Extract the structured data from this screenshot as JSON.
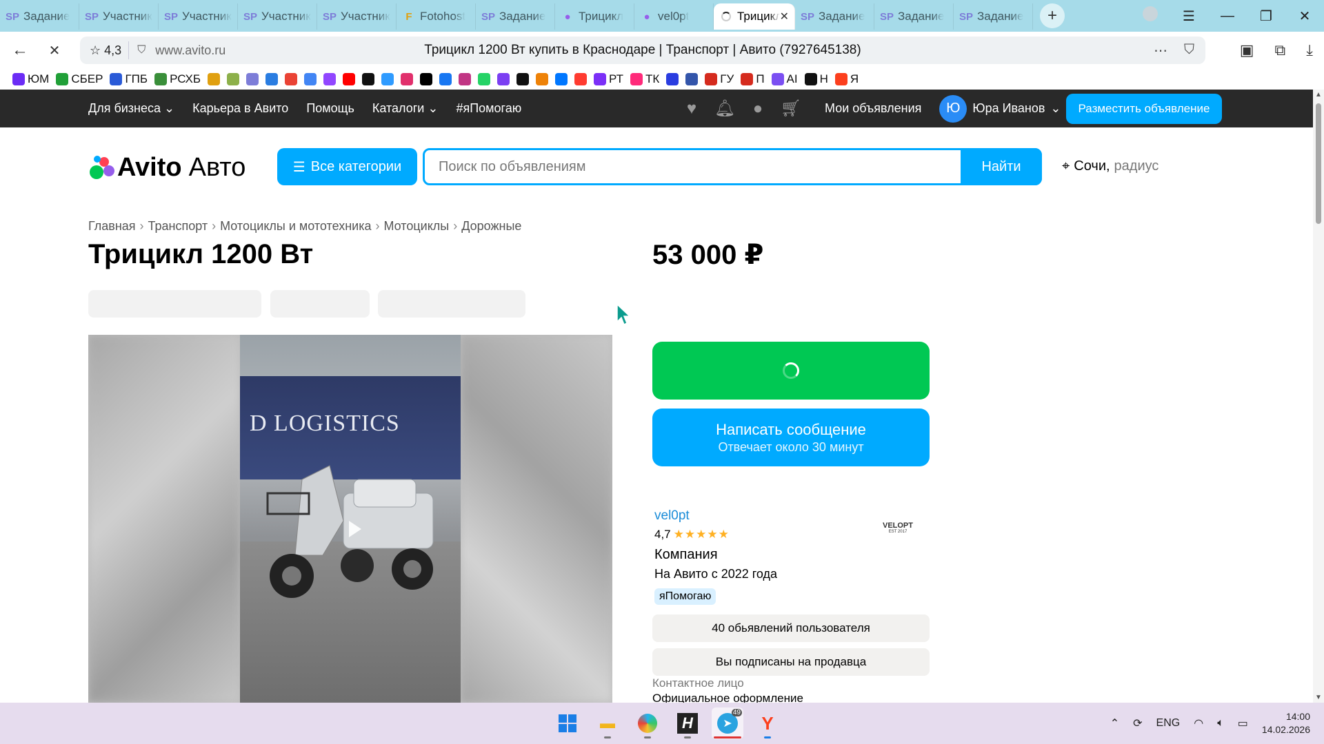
{
  "browser": {
    "tabs": [
      {
        "icon": "sp-icon",
        "title": "Задание"
      },
      {
        "icon": "sp-icon",
        "title": "Участник"
      },
      {
        "icon": "sp-icon",
        "title": "Участник"
      },
      {
        "icon": "sp-icon",
        "title": "Участник"
      },
      {
        "icon": "sp-icon",
        "title": "Участник"
      },
      {
        "icon": "fotohost-icon",
        "title": "Fotohost"
      },
      {
        "icon": "sp-icon",
        "title": "Задание"
      },
      {
        "icon": "avito-icon",
        "title": "Трицикл"
      },
      {
        "icon": "avito-icon",
        "title": "vel0pt"
      },
      {
        "icon": "loading-icon",
        "title": "Трицикл",
        "active": true
      },
      {
        "icon": "sp-icon",
        "title": "Задание"
      },
      {
        "icon": "sp-icon",
        "title": "Задание"
      },
      {
        "icon": "sp-icon",
        "title": "Задание"
      }
    ],
    "site_rating": "4,3",
    "url": "www.avito.ru",
    "page_title": "Трицикл 1200 Вт купить в Краснодаре | Транспорт | Авито (7927645138)",
    "bookmarks": [
      {
        "label": "ЮМ",
        "color": "#6b2cf5"
      },
      {
        "label": "СБЕР",
        "color": "#21a038"
      },
      {
        "label": "ГПБ",
        "color": "#2a5ad7"
      },
      {
        "label": "РСХБ",
        "color": "#3a8f3a"
      },
      {
        "label": "",
        "color": "#e0a010"
      },
      {
        "label": "",
        "color": "#8db04a"
      },
      {
        "label": "",
        "color": "#7d7dd8"
      },
      {
        "label": "",
        "color": "#2a7de1"
      },
      {
        "label": "",
        "color": "#ea4335"
      },
      {
        "label": "",
        "color": "#4285f4"
      },
      {
        "label": "",
        "color": "#9146ff"
      },
      {
        "label": "",
        "color": "#ff0000"
      },
      {
        "label": "",
        "color": "#111111"
      },
      {
        "label": "",
        "color": "#2f9bff"
      },
      {
        "label": "",
        "color": "#e1306c"
      },
      {
        "label": "",
        "color": "#000000"
      },
      {
        "label": "",
        "color": "#1877f2"
      },
      {
        "label": "",
        "color": "#c13584"
      },
      {
        "label": "",
        "color": "#25d366"
      },
      {
        "label": "",
        "color": "#7b3ff2"
      },
      {
        "label": "",
        "color": "#111111"
      },
      {
        "label": "",
        "color": "#ee8208"
      },
      {
        "label": "",
        "color": "#0077ff"
      },
      {
        "label": "",
        "color": "#ff3b30"
      },
      {
        "label": "РТ",
        "color": "#7b2ff7"
      },
      {
        "label": "ТК",
        "color": "#ff2a7a"
      },
      {
        "label": "",
        "color": "#2a3de0"
      },
      {
        "label": "",
        "color": "#3355aa"
      },
      {
        "label": "ГУ",
        "color": "#d52b1e"
      },
      {
        "label": "П",
        "color": "#d52b1e"
      },
      {
        "label": "AI",
        "color": "#7b4ff2"
      },
      {
        "label": "Н",
        "color": "#111111"
      },
      {
        "label": "Я",
        "color": "#fc3f1d"
      }
    ]
  },
  "avito": {
    "topnav": {
      "business": "Для бизнеса",
      "career": "Карьера в Авито",
      "help": "Помощь",
      "catalogs": "Каталоги",
      "ya_pomogayu": "#яПомогаю",
      "my_ads": "Мои объявления",
      "user_initial": "Ю",
      "user_name": "Юра Иванов",
      "post_ad": "Разместить объявление"
    },
    "logo_main": "Avito",
    "logo_sub": "Авто",
    "all_categories": "Все категории",
    "search_placeholder": "Поиск по объявлениям",
    "find": "Найти",
    "location_city": "Сочи,",
    "location_radius": "радиус",
    "breadcrumbs": [
      "Главная",
      "Транспорт",
      "Мотоциклы и мототехника",
      "Мотоциклы",
      "Дорожные"
    ],
    "title": "Трицикл 1200 Вт",
    "price": "53 000 ₽",
    "photo_text": "D LOGISTICS",
    "message_button": "Написать сообщение",
    "message_sub": "Отвечает около 30 минут",
    "seller": {
      "name": "vel0pt",
      "rating": "4,7",
      "stars": "★★★★★",
      "type": "Компания",
      "since": "На Авито с 2022 года",
      "badge": "яПомогаю",
      "logo_text": "VELOPT",
      "logo_sub": "EST 2017"
    },
    "user_ads": "40 обьявлений пользователя",
    "subscribed": "Вы подписаны на продавца",
    "contact_label": "Контактное лицо",
    "contact_value": "Официальное оформление"
  },
  "taskbar": {
    "lang": "ENG",
    "time": "14:00",
    "date": "14.02.2026",
    "telegram_badge": "49"
  }
}
